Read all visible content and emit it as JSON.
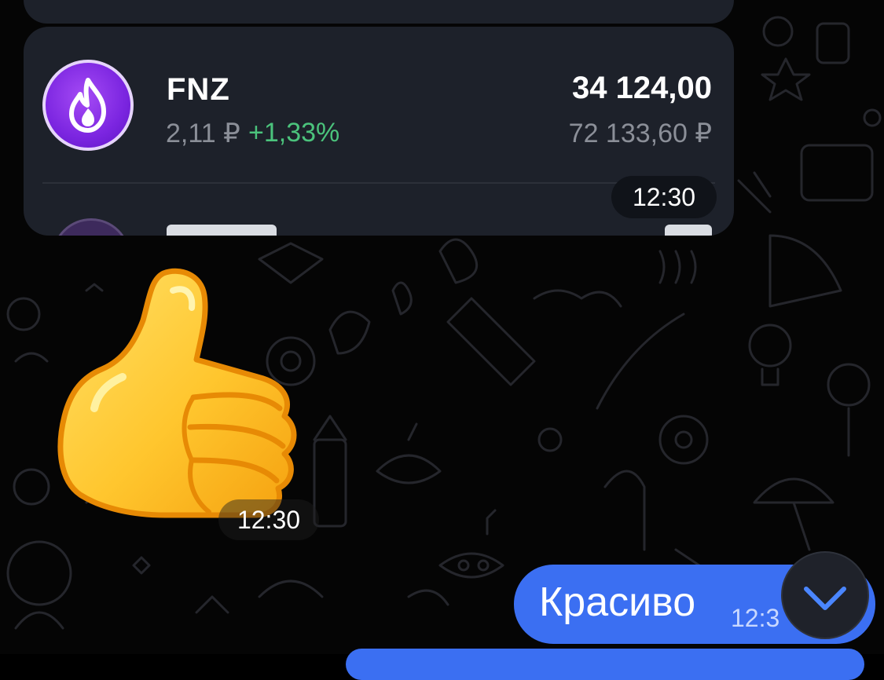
{
  "portfolio_card": {
    "asset": {
      "symbol": "FNZ",
      "price": "2,11 ₽",
      "change": "+1,33%",
      "amount": "34 124,00",
      "value": "72 133,60 ₽",
      "icon": "flame-icon"
    },
    "time": "12:30"
  },
  "sticker": {
    "icon": "thumbs-up-icon",
    "time": "12:30"
  },
  "outgoing_message": {
    "text": "Красиво",
    "time": "12:3"
  },
  "scroll_button": {
    "icon": "chevron-down-icon"
  },
  "colors": {
    "background": "#050505",
    "card": "#1d212a",
    "bubble": "#3b6ff2",
    "positive_change": "#4bc37c",
    "chevron": "#4a86ff"
  }
}
